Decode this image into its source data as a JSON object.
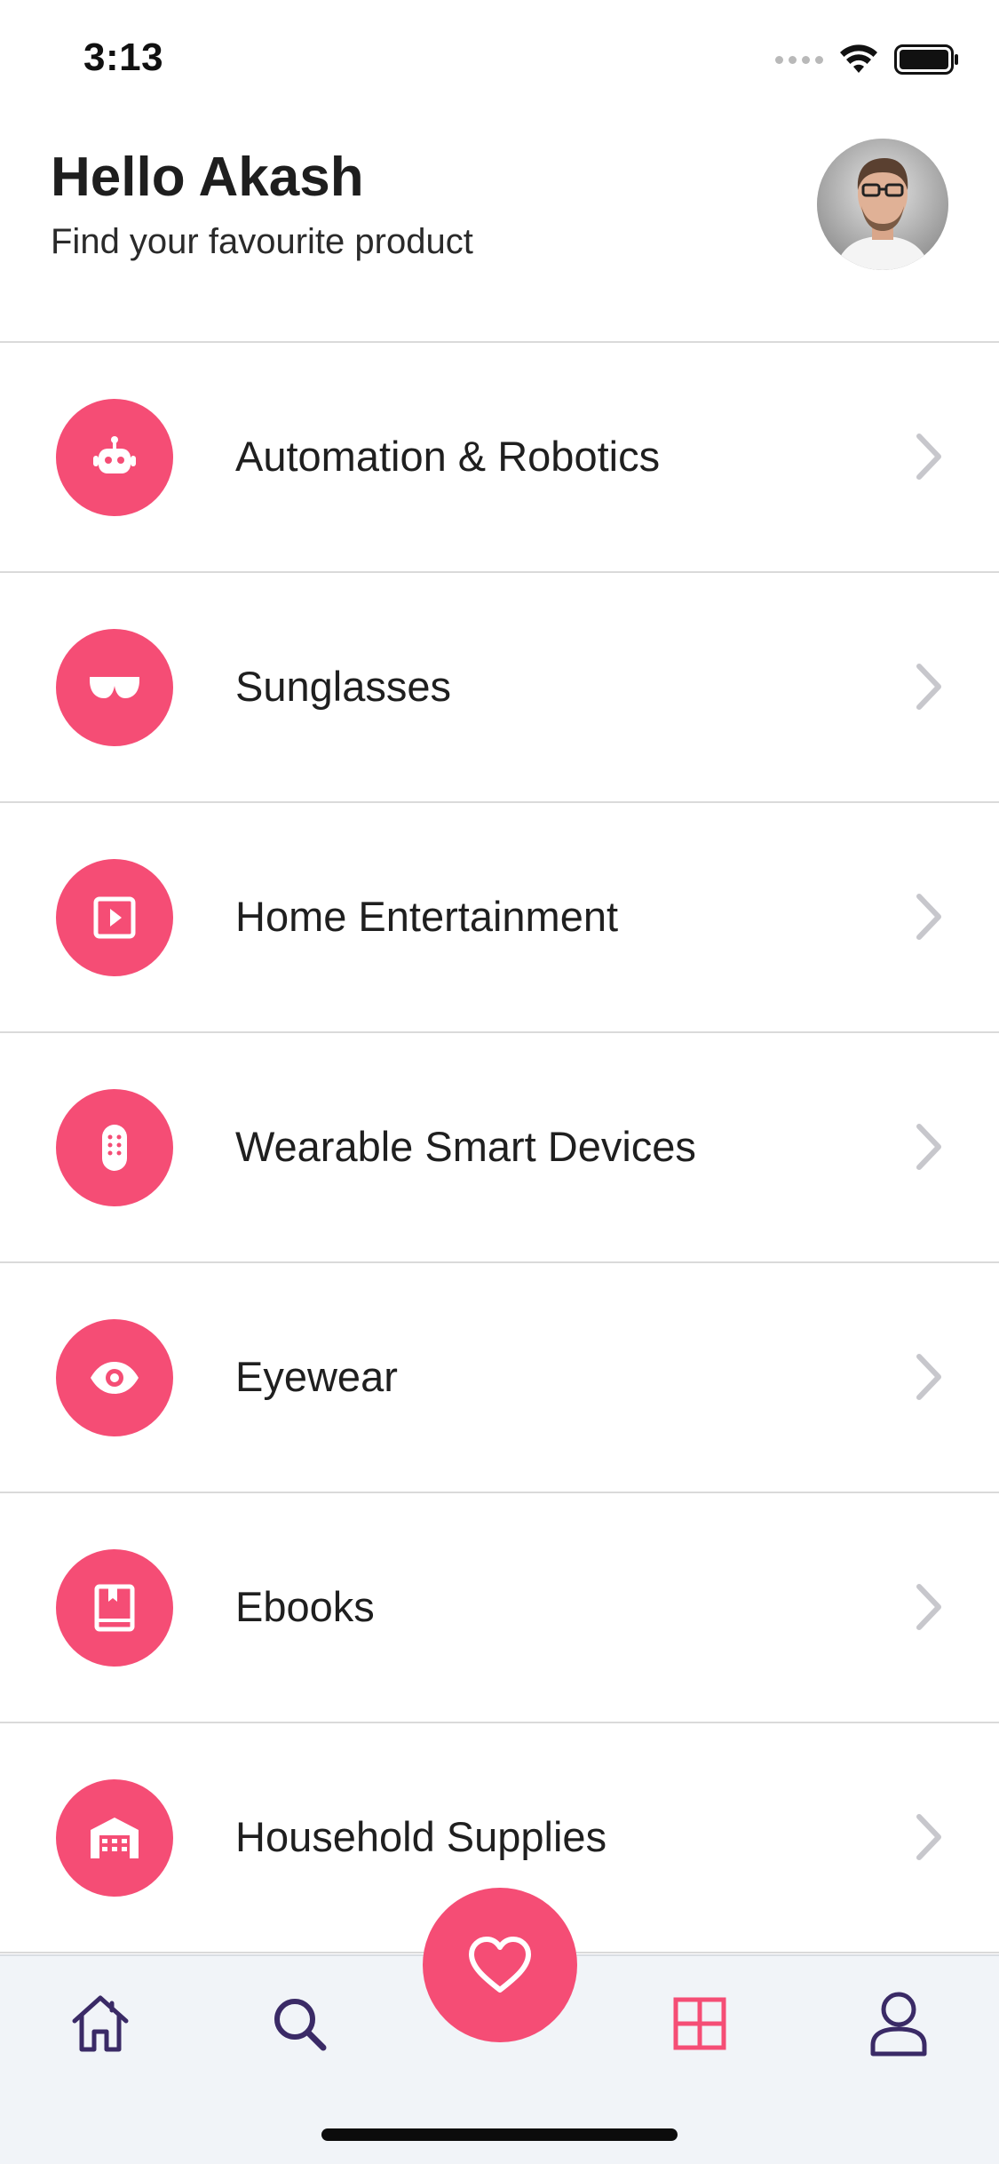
{
  "status_bar": {
    "time": "3:13",
    "icons": [
      "signal-icon",
      "wifi-icon",
      "battery-icon"
    ]
  },
  "header": {
    "greeting": "Hello Akash",
    "subtitle": "Find your favourite product"
  },
  "categories": [
    {
      "label": "Automation & Robotics",
      "icon": "robot-icon"
    },
    {
      "label": "Sunglasses",
      "icon": "sunglasses-icon"
    },
    {
      "label": "Home Entertainment",
      "icon": "play-icon"
    },
    {
      "label": "Wearable Smart Devices",
      "icon": "remote-icon"
    },
    {
      "label": "Eyewear",
      "icon": "eye-icon"
    },
    {
      "label": "Ebooks",
      "icon": "book-icon"
    },
    {
      "label": "Household Supplies",
      "icon": "warehouse-icon"
    }
  ],
  "bottom_nav": {
    "items": [
      {
        "icon": "home-icon",
        "active": false
      },
      {
        "icon": "search-icon",
        "active": false
      },
      {
        "icon": "heart-icon",
        "active": false,
        "fab": true
      },
      {
        "icon": "grid-icon",
        "active": true
      },
      {
        "icon": "user-icon",
        "active": false
      }
    ]
  },
  "colors": {
    "accent": "#f54d75",
    "nav_icon": "#3a2a66",
    "nav_background": "#f1f4f8",
    "divider": "#dadada",
    "chevron": "#c7c7cc"
  }
}
